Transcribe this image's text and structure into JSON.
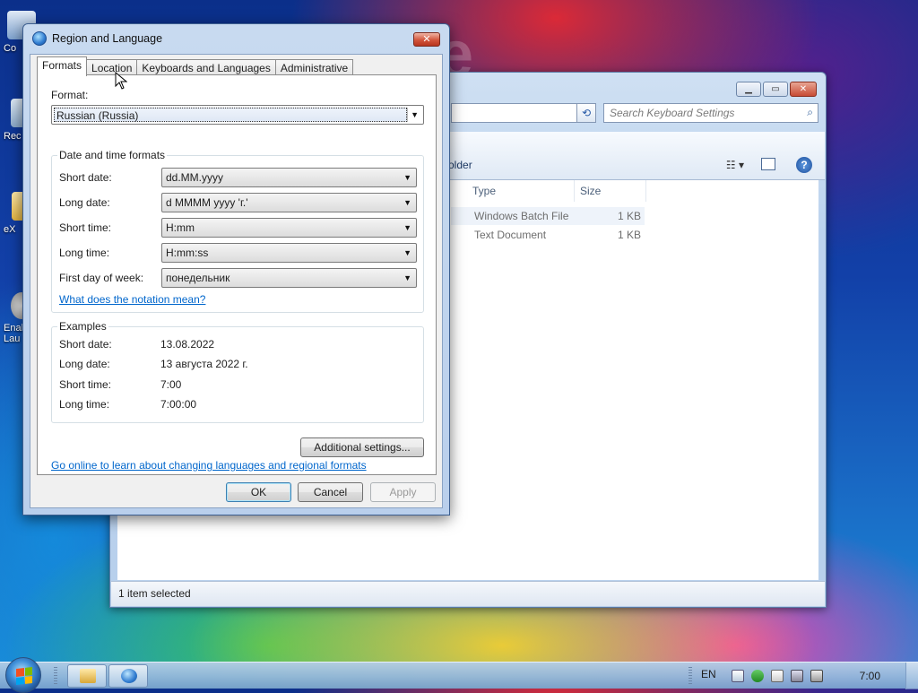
{
  "desktop": {
    "wallpaper_text": "ce",
    "icons": [
      {
        "label": "Co"
      },
      {
        "label": "Rec"
      },
      {
        "label": "eX"
      },
      {
        "label": "Enal Lau"
      }
    ]
  },
  "explorer": {
    "search_placeholder": "Search Keyboard Settings",
    "folder_command": "older",
    "columns": [
      {
        "label": "Type"
      },
      {
        "label": "Size"
      }
    ],
    "rows": [
      {
        "type": "Windows Batch File",
        "size": "1 KB",
        "selected": true
      },
      {
        "type": "Text Document",
        "size": "1 KB",
        "selected": false
      }
    ],
    "status": "1 item selected"
  },
  "dialog": {
    "title": "Region and Language",
    "tabs": [
      {
        "label": "Formats",
        "active": true
      },
      {
        "label": "Location",
        "active": false
      },
      {
        "label": "Keyboards and Languages",
        "active": false
      },
      {
        "label": "Administrative",
        "active": false
      }
    ],
    "format_label": "Format:",
    "format_value": "Russian (Russia)",
    "datetime_group_title": "Date and time formats",
    "fields": [
      {
        "label": "Short date:",
        "value": "dd.MM.yyyy"
      },
      {
        "label": "Long date:",
        "value": "d MMMM yyyy 'г.'"
      },
      {
        "label": "Short time:",
        "value": "H:mm"
      },
      {
        "label": "Long time:",
        "value": "H:mm:ss"
      },
      {
        "label": "First day of week:",
        "value": "понедельник"
      }
    ],
    "notation_link": "What does the notation mean?",
    "examples_group_title": "Examples",
    "examples": [
      {
        "label": "Short date:",
        "value": "13.08.2022"
      },
      {
        "label": "Long date:",
        "value": "13 августа 2022 г."
      },
      {
        "label": "Short time:",
        "value": "7:00"
      },
      {
        "label": "Long time:",
        "value": "7:00:00"
      }
    ],
    "additional_settings": "Additional settings...",
    "online_link": "Go online to learn about changing languages and regional formats",
    "ok": "OK",
    "cancel": "Cancel",
    "apply": "Apply",
    "close_glyph": "✕"
  },
  "taskbar": {
    "language": "EN",
    "clock": "7:00"
  }
}
